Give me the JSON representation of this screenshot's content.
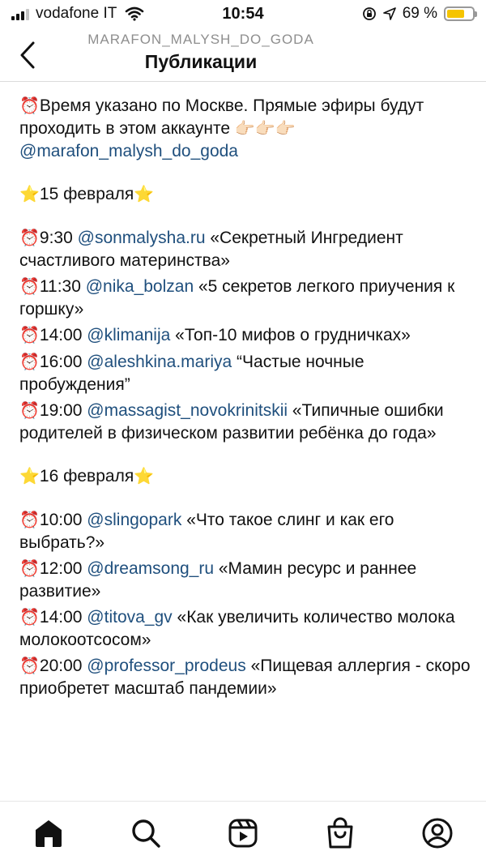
{
  "status_bar": {
    "carrier": "vodafone IT",
    "time": "10:54",
    "battery_percent": "69 %",
    "battery_level": 0.69,
    "battery_color": "#f5c400"
  },
  "header": {
    "account": "MARAFON_MALYSH_DO_GODA",
    "title": "Публикации",
    "back_icon": "chevron-left-icon"
  },
  "post": {
    "intro": {
      "emoji": "⏰",
      "text": "Время указано по Москве. Прямые эфиры будут проходить в этом аккаунте",
      "pointers": "👉🏻👉🏻👉🏻",
      "handle": "@marafon_malysh_do_goda"
    },
    "days": [
      {
        "star": "⭐",
        "date": "15 февраля",
        "items": [
          {
            "emoji": "⏰",
            "time": "9:30  ",
            "handle": "@sonmalysha.ru",
            "topic": "«Секретный Ингредиент счастливого материнства»"
          },
          {
            "emoji": "⏰",
            "time": "11:30 ",
            "handle": "@nika_bolzan",
            "topic": "«5 секретов легкого приучения к горшку»"
          },
          {
            "emoji": "⏰",
            "time": "14:00 ",
            "handle": "@klimanija",
            "topic": "«Топ-10 мифов о грудничках»"
          },
          {
            "emoji": "⏰",
            "time": "16:00 ",
            "handle": "@aleshkina.mariya",
            "topic": "“Частые ночные пробуждения”"
          },
          {
            "emoji": "⏰",
            "time": "19:00 ",
            "handle": "@massagist_novokrinitskii",
            "topic": "«Типичные ошибки родителей в физическом развитии ребёнка до года»"
          }
        ]
      },
      {
        "star": "⭐",
        "date": "16 февраля",
        "items": [
          {
            "emoji": "⏰",
            "time": "10:00 ",
            "handle": "@slingopark",
            "topic": "«Что такое слинг и как его выбрать?»"
          },
          {
            "emoji": "⏰",
            "time": "12:00 ",
            "handle": "@dreamsong_ru",
            "topic": "«Мамин ресурс и раннее развитие»"
          },
          {
            "emoji": "⏰",
            "time": "14:00 ",
            "handle": "@titova_gv",
            "topic": "«Как увеличить количество молока молокоотсосом»"
          },
          {
            "emoji": "⏰",
            "time": "20:00 ",
            "handle": "@professor_prodeus",
            "topic": " «Пищевая аллергия - скоро приобретет масштаб пандемии»"
          }
        ]
      }
    ]
  },
  "bottom_nav": [
    {
      "name": "home",
      "icon": "home-icon"
    },
    {
      "name": "search",
      "icon": "search-icon"
    },
    {
      "name": "reels",
      "icon": "reels-icon"
    },
    {
      "name": "shop",
      "icon": "shopping-bag-icon"
    },
    {
      "name": "profile",
      "icon": "profile-icon"
    }
  ],
  "colors": {
    "handle": "#1f4f7d",
    "secondary_text": "#8e8e8e"
  }
}
